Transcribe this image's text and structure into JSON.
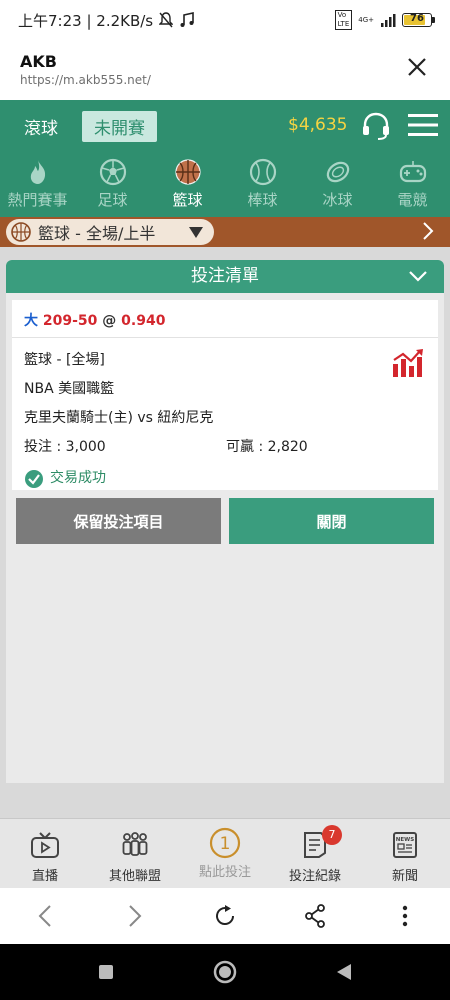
{
  "status_bar": {
    "time_info": "上午7:23 | 2.2KB/s",
    "network": "4G+",
    "battery": "76"
  },
  "browser": {
    "title": "AKB",
    "url": "https://m.akb555.net/"
  },
  "app_nav": {
    "tab_live": "滾球",
    "tab_upcoming": "未開賽",
    "balance": "$4,635"
  },
  "sports": [
    {
      "label": "熱門賽事",
      "icon": "fire-icon"
    },
    {
      "label": "足球",
      "icon": "soccer-icon"
    },
    {
      "label": "籃球",
      "icon": "basketball-icon"
    },
    {
      "label": "棒球",
      "icon": "baseball-icon"
    },
    {
      "label": "冰球",
      "icon": "hockey-icon"
    },
    {
      "label": "電競",
      "icon": "gamepad-icon"
    }
  ],
  "filter": {
    "label": "籃球 - 全場/上半"
  },
  "slip": {
    "title": "投注清單",
    "selection_type": "大",
    "selection_line": "209-50",
    "at": "@",
    "odds": "0.940",
    "sport_line": "籃球 - [全場]",
    "league": "NBA 美國職籃",
    "match": "克里夫蘭騎士(主) vs 紐約尼克",
    "stake": "投注 : 3,000",
    "to_win": "可贏 : 2,820",
    "status": "交易成功",
    "keep_button": "保留投注項目",
    "close_button": "關閉"
  },
  "bottom_nav": [
    {
      "label": "直播",
      "icon": "tv-icon"
    },
    {
      "label": "其他聯盟",
      "icon": "people-icon"
    },
    {
      "label": "點此投注",
      "icon": "number-one-icon"
    },
    {
      "label": "投注紀錄",
      "icon": "document-icon",
      "badge": "7"
    },
    {
      "label": "新聞",
      "icon": "news-icon"
    }
  ],
  "colors": {
    "primary": "#2f8f6f",
    "balance": "#f5d442",
    "filter_bar": "#a0562a",
    "odds_red": "#d3262d",
    "selection_blue": "#1b5fcf"
  }
}
